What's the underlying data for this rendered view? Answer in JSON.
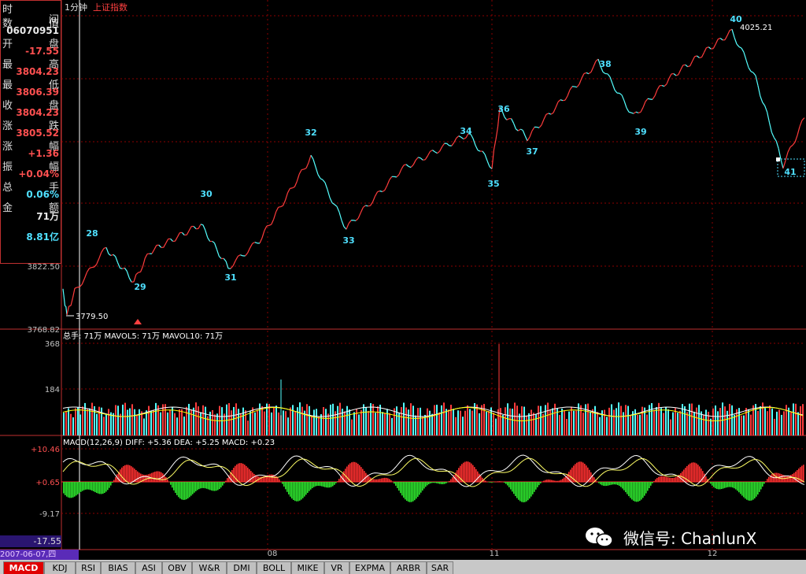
{
  "header": {
    "period": "1分钟",
    "index_name": "上证指数",
    "col_time": "时",
    "col_time2": "间"
  },
  "info_panel": [
    {
      "k1": "数",
      "k2": "值",
      "v": "06070951",
      "cls": "white"
    },
    {
      "k1": "开",
      "k2": "盘",
      "v": "-17.55",
      "cls": "red"
    },
    {
      "k1": "最",
      "k2": "高",
      "v": "3804.23",
      "cls": "red"
    },
    {
      "k1": "最",
      "k2": "低",
      "v": "3806.39",
      "cls": "red"
    },
    {
      "k1": "收",
      "k2": "盘",
      "v": "3804.23",
      "cls": "red"
    },
    {
      "k1": "涨",
      "k2": "跌",
      "v": "3805.52",
      "cls": "red"
    },
    {
      "k1": "涨",
      "k2": "幅",
      "v": "+1.36",
      "cls": "red"
    },
    {
      "k1": "振",
      "k2": "幅",
      "v": "+0.04%",
      "cls": "red"
    },
    {
      "k1": "总",
      "k2": "手",
      "v": "0.06%",
      "cls": "cyan"
    },
    {
      "k1": "金",
      "k2": "额",
      "v": "71万",
      "cls": "white"
    },
    {
      "k1": "",
      "k2": "",
      "v": "8.81亿",
      "cls": "cyan"
    }
  ],
  "price_axis": [
    "3822.50",
    "3768.82"
  ],
  "price_high_label": "4025.21",
  "price_low_label": "3779.50",
  "wave_labels": [
    "28",
    "29",
    "30",
    "31",
    "32",
    "33",
    "34",
    "35",
    "36",
    "37",
    "38",
    "39",
    "40",
    "41"
  ],
  "volume_panel": {
    "title": "总手: 71万  MAVOL5: 71万  MAVOL10: 71万",
    "axis": [
      "368",
      "184"
    ]
  },
  "macd_panel": {
    "title": "MACD(12,26,9)  DIFF: +5.36  DEA: +5.25  MACD: +0.23",
    "axis": [
      "+10.46",
      "+0.65",
      "-9.17",
      "-17.55"
    ]
  },
  "date_labels": [
    "08",
    "11",
    "12"
  ],
  "current_date": "2007-06-07,四",
  "tabs": [
    "MACD",
    "KDJ",
    "RSI",
    "BIAS",
    "ASI",
    "OBV",
    "W&R",
    "DMI",
    "BOLL",
    "MIKE",
    "VR",
    "EXPMA",
    "ARBR",
    "SAR"
  ],
  "watermark": "微信号: ChanlunX",
  "colors": {
    "up": "#ff3c3c",
    "down": "#54ffff",
    "grid": "#8b0000",
    "axis": "#c03030",
    "label": "#4fe0ff"
  },
  "chart_data": {
    "type": "line",
    "title": "上证指数 1分钟",
    "x": [
      "2007-06-07",
      "08",
      "11",
      "12"
    ],
    "series": [
      {
        "values": [
          3779.5,
          3870,
          3845,
          3920,
          3880,
          3985,
          3900,
          3975,
          3930,
          4000,
          3960,
          4010,
          3975,
          4025.21,
          3930
        ]
      }
    ],
    "ylim": [
      3768.82,
      4040
    ]
  }
}
